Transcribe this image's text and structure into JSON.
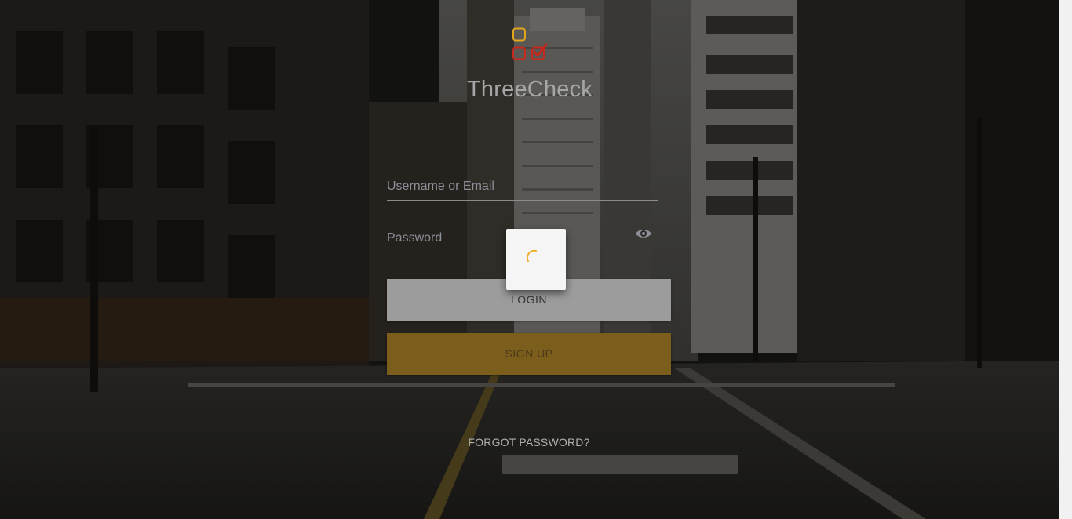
{
  "app": {
    "brand_name": "ThreeCheck",
    "logo_icon": "three-check-logo",
    "colors": {
      "logo_yellow": "#e3a51e",
      "logo_red": "#c5281c",
      "signup_gold": "#7c5e1c",
      "spinner": "#f0ad2a"
    }
  },
  "form": {
    "username": {
      "placeholder": "Username or Email",
      "value": ""
    },
    "password": {
      "placeholder": "Password",
      "value": "",
      "toggle_icon": "eye-icon"
    },
    "login_label": "LOGIN",
    "signup_label": "SIGN UP",
    "forgot_label": "FORGOT PASSWORD?"
  },
  "loader": {
    "icon": "spinner-icon"
  }
}
